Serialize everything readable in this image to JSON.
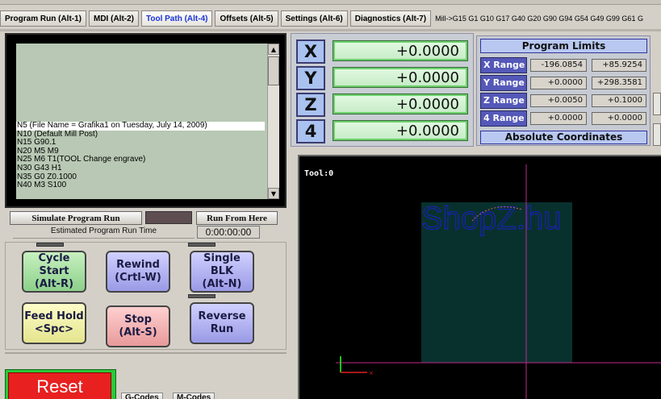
{
  "tabs": [
    {
      "label": "Program Run (Alt-1)",
      "active": false
    },
    {
      "label": "MDI (Alt-2)",
      "active": false
    },
    {
      "label": "Tool Path (Alt-4)",
      "active": true
    },
    {
      "label": "Offsets (Alt-5)",
      "active": false
    },
    {
      "label": "Settings (Alt-6)",
      "active": false
    },
    {
      "label": "Diagnostics (Alt-7)",
      "active": false
    }
  ],
  "active_gcodes": "Mill->G15  G1 G10 G17 G40 G20 G90 G94 G54 G49 G99 G61 G",
  "gcode_lines": [
    "N5 (File Name = Grafika1 on Tuesday, July 14, 2009)",
    "N10 (Default Mill Post)",
    "N15  G90.1",
    "N20 M5 M9",
    "N25 M6 T1(TOOL Change engrave)",
    "N30 G43 H1",
    "N35 G0  Z0.1000",
    "N40 M3 S100"
  ],
  "selected_line_index": 0,
  "program": {
    "simulate_label": "Simulate Program Run",
    "run_from_here_label": "Run From Here",
    "estimated_label": "Estimated Program Run Time",
    "estimated_time": "0:00:00:00"
  },
  "controls": {
    "cycle_start": [
      "Cycle Start",
      "(Alt-R)"
    ],
    "rewind": [
      "Rewind",
      "(Crtl-W)"
    ],
    "single_blk": [
      "Single BLK",
      "(Alt-N)"
    ],
    "feed_hold": [
      "Feed Hold",
      "<Spc>"
    ],
    "stop": [
      "Stop",
      "(Alt-S)"
    ],
    "reverse_run": [
      "Reverse",
      "Run"
    ]
  },
  "reset_label": "Reset",
  "bottom_tabs": [
    "G-Codes",
    "M-Codes"
  ],
  "dro": [
    {
      "axis": "X",
      "value": "+0.0000"
    },
    {
      "axis": "Y",
      "value": "+0.0000"
    },
    {
      "axis": "Z",
      "value": "+0.0000"
    },
    {
      "axis": "4",
      "value": "+0.0000"
    }
  ],
  "limits": {
    "title": "Program Limits",
    "rows": [
      {
        "label": "X Range",
        "min": "-196.0854",
        "max": "+85.9254"
      },
      {
        "label": "Y Range",
        "min": "+0.0000",
        "max": "+298.3581"
      },
      {
        "label": "Z Range",
        "min": "+0.0050",
        "max": "+0.1000"
      },
      {
        "label": "4 Range",
        "min": "+0.0000",
        "max": "+0.0000"
      }
    ],
    "footer": "Absolute Coordinates"
  },
  "toolpath": {
    "tool_label": "Tool:0",
    "engraved_text": "ShopZ.hu",
    "colors": {
      "background": "#000000",
      "stock": "#08312e",
      "engrave": "#1e1ecc",
      "crosshair": "#c0288c",
      "axis_x": "#e02020",
      "axis_y": "#20c020"
    }
  }
}
